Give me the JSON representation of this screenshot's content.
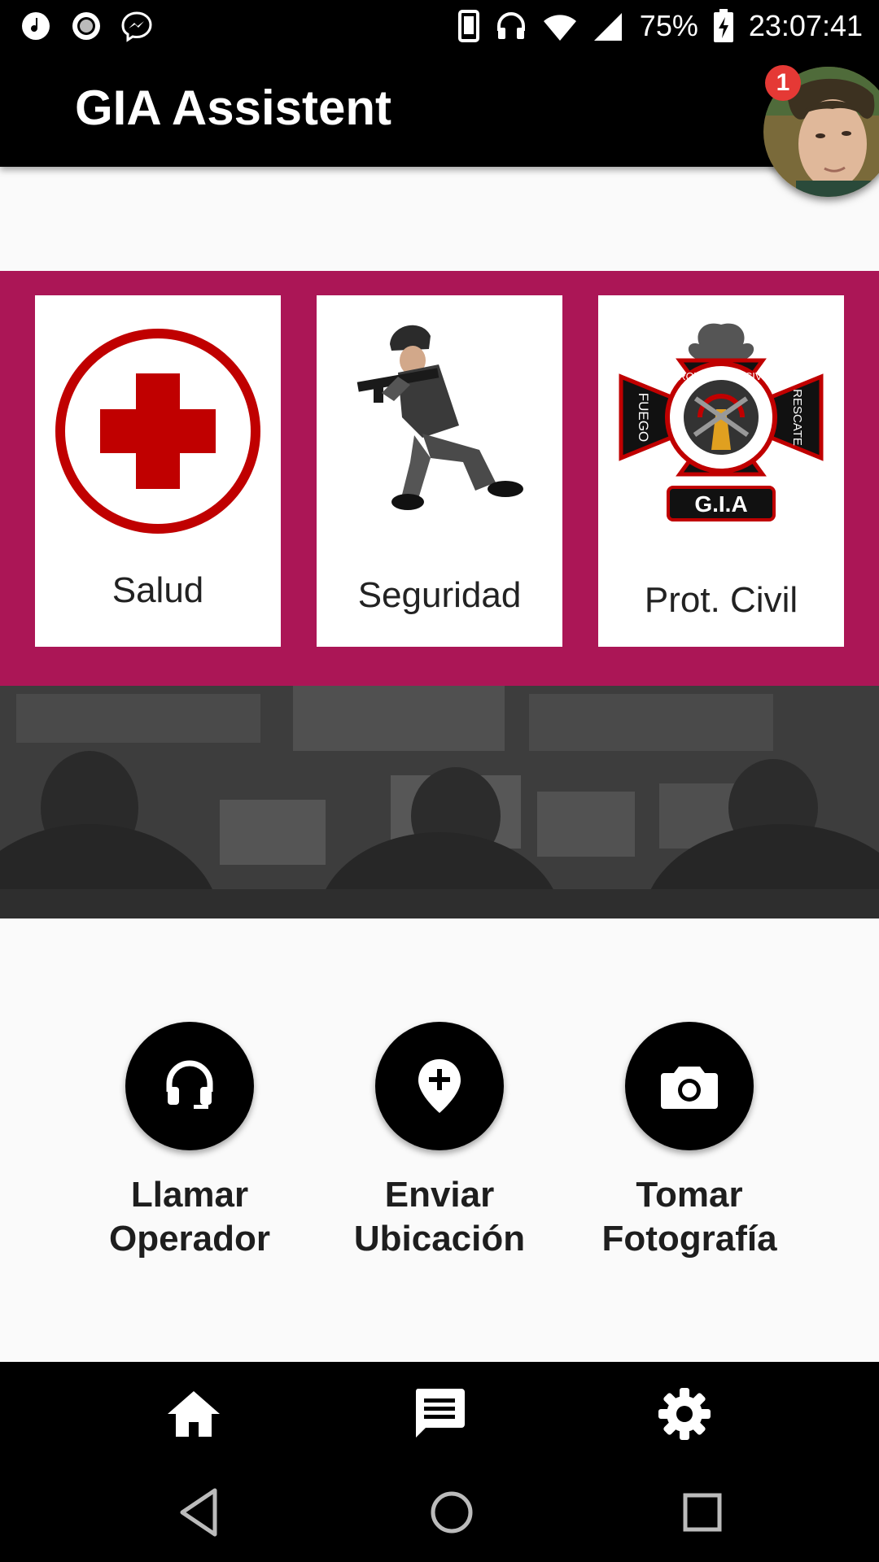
{
  "status_bar": {
    "battery": "75%",
    "time": "23:07:41"
  },
  "app_bar": {
    "title": "GIA Assistent",
    "notification_count": "1"
  },
  "categories": [
    {
      "label": "Salud",
      "icon": "red-cross-icon"
    },
    {
      "label": "Seguridad",
      "icon": "police-officer-image"
    },
    {
      "label": "Prot. Civil",
      "icon": "civil-protection-emblem"
    }
  ],
  "emblem": {
    "top_text": "PROTECCION CIVIL",
    "left_text": "FUEGO",
    "right_text": "RESCATE",
    "bottom_text": "G.I.A"
  },
  "actions": [
    {
      "line1": "Llamar",
      "line2": "Operador",
      "icon": "headset-icon"
    },
    {
      "line1": "Enviar",
      "line2": "Ubicación",
      "icon": "add-location-icon"
    },
    {
      "line1": "Tomar",
      "line2": "Fotografía",
      "icon": "camera-icon"
    }
  ],
  "bottom_nav": [
    "home-icon",
    "chat-icon",
    "settings-icon"
  ],
  "colors": {
    "band": "#ab1656",
    "app_bar": "#000000",
    "background": "#fafafa",
    "cross_red": "#c00000"
  }
}
